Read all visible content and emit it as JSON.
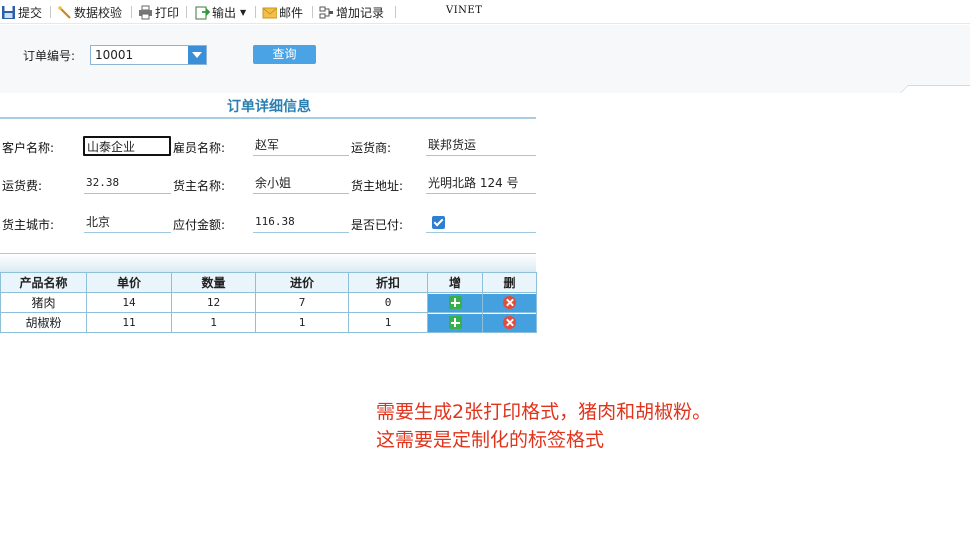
{
  "toolbar": {
    "submit": "提交",
    "validate": "数据校验",
    "print": "打印",
    "export": "输出",
    "mail": "邮件",
    "add_record": "增加记录",
    "brand": "VINET"
  },
  "query": {
    "order_no_label": "订单编号:",
    "order_no_value": "10001",
    "query_button": "查询"
  },
  "form": {
    "title": "订单详细信息",
    "customer_label": "客户名称:",
    "customer_value": "山泰企业",
    "employee_label": "雇员名称:",
    "employee_value": "赵军",
    "shipper_label": "运货商:",
    "shipper_value": "联邦货运",
    "freight_label": "运货费:",
    "freight_value": "32.38",
    "consignee_label": "货主名称:",
    "consignee_value": "余小姐",
    "address_label": "货主地址:",
    "address_value": "光明北路 124 号",
    "city_label": "货主城市:",
    "city_value": "北京",
    "amount_label": "应付金额:",
    "amount_value": "116.38",
    "paid_label": "是否已付:",
    "paid": true
  },
  "table": {
    "headers": [
      "产品名称",
      "单价",
      "数量",
      "进价",
      "折扣",
      "增",
      "删"
    ],
    "rows": [
      {
        "product": "猪肉",
        "price": "14",
        "qty": "12",
        "cost": "7",
        "discount": "0"
      },
      {
        "product": "胡椒粉",
        "price": "11",
        "qty": "1",
        "cost": "1",
        "discount": "1"
      }
    ]
  },
  "note": {
    "line1": "需要生成2张打印格式，猪肉和胡椒粉。",
    "line2": "这需要是定制化的标签格式"
  },
  "colors": {
    "accent": "#4aa3e4",
    "title": "#2b7fb0",
    "note": "#e0341c",
    "add": "#35b04a",
    "delete": "#e34b3b"
  }
}
